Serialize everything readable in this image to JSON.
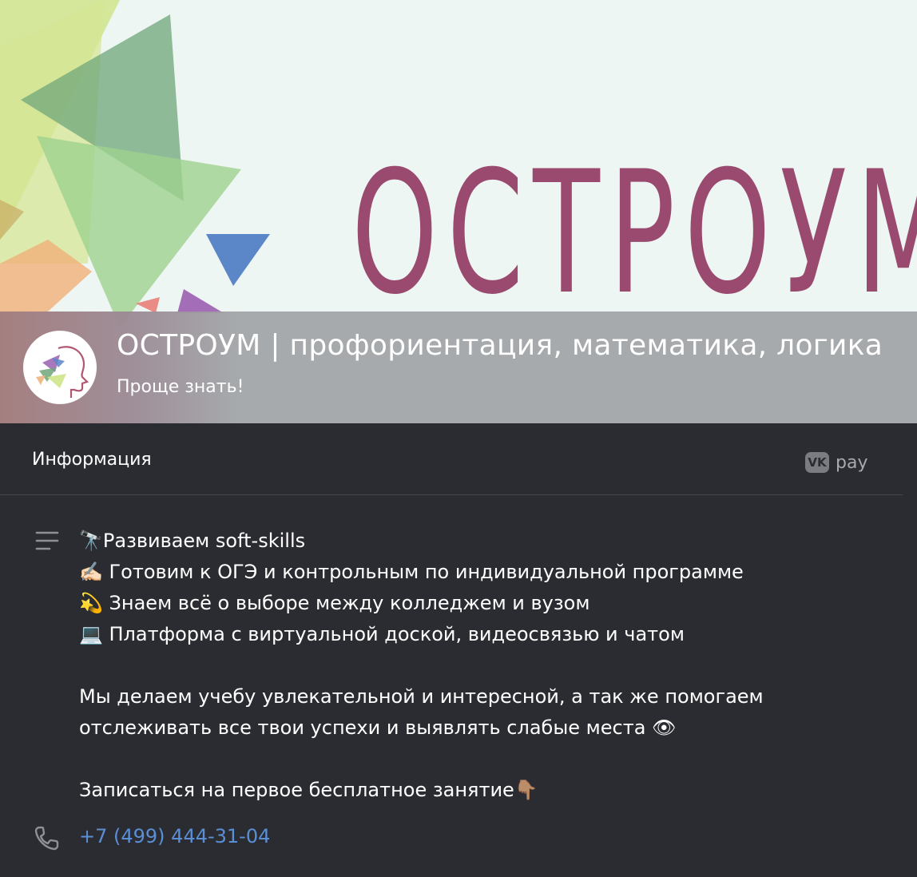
{
  "cover": {
    "brand_word": "ОСТРОУМ",
    "brand_color": "#9a4a6e"
  },
  "header": {
    "group_name": "ОСТРОУМ | профориентация, математика, логика",
    "status": "Проще знать!",
    "avatar_icon": "head-with-triangles-logo"
  },
  "info": {
    "title": "Информация",
    "vkpay_logo": "VK",
    "vkpay_label": "pay",
    "description_icon": "text-lines-icon",
    "description_lines": [
      "🔭Развиваем soft-skills",
      "✍🏻 Готовим к ОГЭ и контрольным по индивидуальной программе",
      "💫 Знаем всё о выборе между колледжем и вузом",
      "💻 Платформа с виртуальной доской, видеосвязью и чатом",
      "",
      "Мы делаем учебу увлекательной и интересной, а так же помогаем",
      "отслеживать все твои успехи и выявлять слабые места 👁",
      "",
      "Записаться на первое бесплатное занятие👇🏽"
    ],
    "phone_icon": "phone-icon",
    "phone": "+7 (499) 444-31-04",
    "link_color": "#5a8fd6"
  }
}
